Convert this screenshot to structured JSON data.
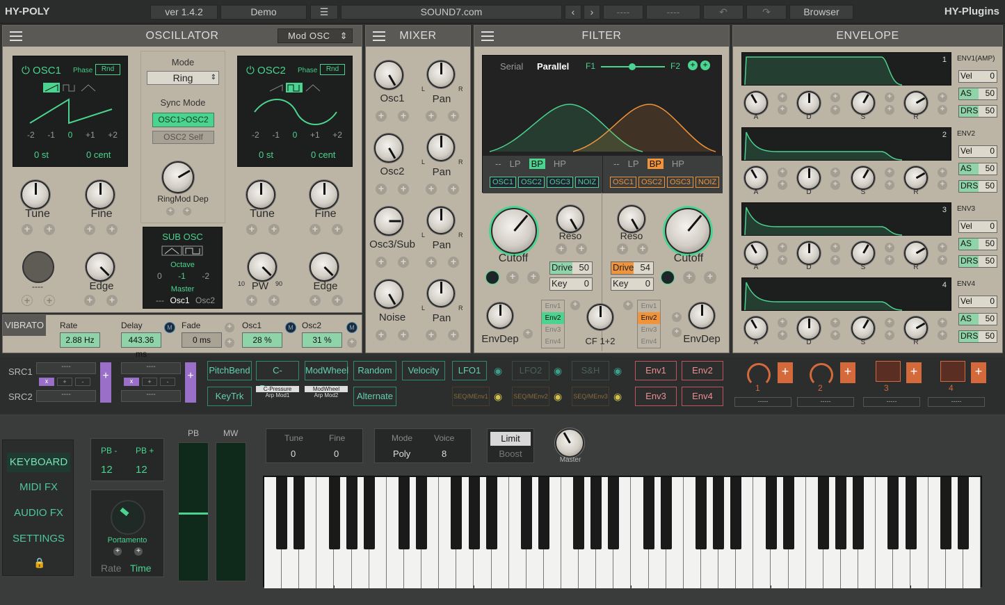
{
  "app": {
    "left_title": "HY-POLY",
    "right_title": "HY-Plugins",
    "version": "ver 1.4.2",
    "preset": "Demo",
    "preset_name": "SOUND7.com",
    "slot_a": "----",
    "slot_b": "----",
    "browser": "Browser"
  },
  "oscillator": {
    "title": "OSCILLATOR",
    "mod_select": "Mod OSC",
    "osc1": {
      "name": "OSC1",
      "phase": "Phase",
      "rnd": "Rnd",
      "ticks": [
        "-2",
        "-1",
        "0",
        "+1",
        "+2"
      ],
      "st": "0 st",
      "cent": "0 cent"
    },
    "osc2": {
      "name": "OSC2",
      "phase": "Phase",
      "rnd": "Rnd",
      "ticks": [
        "-2",
        "-1",
        "0",
        "+1",
        "+2"
      ],
      "st": "0 st",
      "cent": "0 cent"
    },
    "mode_label": "Mode",
    "mode_value": "Ring",
    "sync_label": "Sync Mode",
    "sync_on": "OSC1>OSC2",
    "sync_off": "OSC2 Self",
    "ringmod": "RingMod Dep",
    "sub": {
      "title": "SUB OSC",
      "octave": "Octave",
      "oct_vals": [
        "0",
        "-1",
        "-2"
      ],
      "master": "Master",
      "m0": "---",
      "m1": "Osc1",
      "m2": "Osc2"
    },
    "knobs": {
      "tune": "Tune",
      "fine": "Fine",
      "edge": "Edge",
      "pw": "PW",
      "pw_min": "10",
      "pw_max": "90",
      "empty": "----",
      "minus": "-",
      "plus": "+"
    }
  },
  "vibrato": {
    "title": "VIBRATO",
    "rate_l": "Rate",
    "rate": "2.88 Hz",
    "delay_l": "Delay",
    "delay": "443.36 ms",
    "fade_l": "Fade",
    "fade": "0 ms",
    "osc1_l": "Osc1",
    "osc1": "28 %",
    "osc2_l": "Osc2",
    "osc2": "31 %",
    "m": "M"
  },
  "mixer": {
    "title": "MIXER",
    "labels": [
      "Osc1",
      "Osc2",
      "Osc3/Sub",
      "Noise"
    ],
    "pan": "Pan",
    "l": "L",
    "r": "R"
  },
  "filter": {
    "title": "FILTER",
    "serial": "Serial",
    "parallel": "Parallel",
    "f1": "F1",
    "f2": "F2",
    "types": [
      "--",
      "LP",
      "BP",
      "HP"
    ],
    "srcs": [
      "OSC1",
      "OSC2",
      "OSC3",
      "NOIZ"
    ],
    "cutoff": "Cutoff",
    "reso": "Reso",
    "drive": "Drive",
    "drive1": "50",
    "drive2": "54",
    "key": "Key",
    "key1": "0",
    "key2": "0",
    "envs": [
      "Env1",
      "Env2",
      "Env3",
      "Env4"
    ],
    "envdep": "EnvDep",
    "cf": "CF 1+2",
    "plus": "+"
  },
  "envelope": {
    "title": "ENVELOPE",
    "rows": [
      {
        "num": "1",
        "name": "ENV1(AMP)",
        "vel": "0",
        "as": "50",
        "drs": "50"
      },
      {
        "num": "2",
        "name": "ENV2",
        "vel": "0",
        "as": "50",
        "drs": "50"
      },
      {
        "num": "3",
        "name": "ENV3",
        "vel": "0",
        "as": "50",
        "drs": "50"
      },
      {
        "num": "4",
        "name": "ENV4",
        "vel": "0",
        "as": "50",
        "drs": "50"
      }
    ],
    "vel_l": "Vel",
    "as_l": "AS",
    "drs_l": "DRS",
    "knobs": [
      "A",
      "D",
      "S",
      "R"
    ]
  },
  "mod": {
    "src1": "SRC1",
    "src2": "SRC2",
    "dash": "----",
    "x": "x",
    "p": "+",
    "m": "-",
    "bigplus": "+",
    "sources": [
      "PitchBend",
      "C-Pressure",
      "ModWheel",
      "Random",
      "Velocity",
      "KeyTrk",
      "Alternate"
    ],
    "cp_small": [
      "C-Pressure",
      "Arp Mod1"
    ],
    "mw_small": [
      "ModWheel",
      "Arp Mod2"
    ],
    "lfo": [
      "LFO1",
      "LFO2",
      "S&H"
    ],
    "seq": [
      "SEQ/MEnv1",
      "SEQ/MEnv2",
      "SEQ/MEnv3"
    ],
    "envs": [
      "Env1",
      "Env2",
      "Env3",
      "Env4"
    ],
    "macros": [
      "1",
      "2",
      "3",
      "4"
    ],
    "macro_names": [
      "-----",
      "-----",
      "-----",
      "-----"
    ]
  },
  "keyboard": {
    "side": [
      "KEYBOARD",
      "MIDI FX",
      "AUDIO FX",
      "SETTINGS"
    ],
    "pbm_l": "PB -",
    "pbp_l": "PB +",
    "pbm": "12",
    "pbp": "12",
    "pb": "PB",
    "mw": "MW",
    "portamento": "Portamento",
    "rate": "Rate",
    "time": "Time",
    "tune_l": "Tune",
    "fine_l": "Fine",
    "tune": "0",
    "fine": "0",
    "mode_l": "Mode",
    "voice_l": "Voice",
    "mode": "Poly",
    "voice": "8",
    "limit": "Limit",
    "boost": "Boost",
    "master": "Master"
  },
  "colors": {
    "accent": "#4bd48f",
    "filter2": "#f0943c",
    "panel": "#bcb5a6",
    "pink": "#c0555e",
    "teal": "#2e8b72"
  }
}
